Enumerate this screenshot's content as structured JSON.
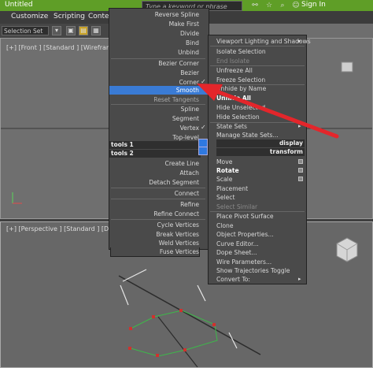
{
  "window": {
    "title": "Untitled"
  },
  "menubar": {
    "items": [
      "Customize",
      "Scripting",
      "Conte"
    ]
  },
  "search": {
    "placeholder": "Type a keyword or phrase"
  },
  "header_icons": [
    "binoculars-icon",
    "star-icon",
    "search-icon",
    "user-icon"
  ],
  "signin": "Sign In",
  "toolbar": {
    "selection_set": "Selection Set"
  },
  "viewports": {
    "front": "[+] [Front ] [Standard ] [Wireframe",
    "perspective": "[+] [Perspective ] [Standard ] [Defa"
  },
  "quad_left": {
    "group1": [
      {
        "label": "Reverse Spline",
        "checked": false
      },
      {
        "label": "Make First",
        "checked": false
      },
      {
        "label": "Divide",
        "checked": false
      },
      {
        "label": "Bind",
        "checked": false
      },
      {
        "label": "Unbind",
        "checked": false
      }
    ],
    "group2": [
      {
        "label": "Bezier Corner",
        "checked": false
      },
      {
        "label": "Bezier",
        "checked": false
      },
      {
        "label": "Corner",
        "checked": true
      },
      {
        "label": "Smooth",
        "checked": false,
        "highlighted": true
      },
      {
        "label": "Reset Tangents",
        "checked": false
      }
    ],
    "group3": [
      {
        "label": "Spline",
        "checked": false
      },
      {
        "label": "Segment",
        "checked": false
      },
      {
        "label": "Vertex",
        "checked": true
      },
      {
        "label": "Top-level",
        "checked": false
      }
    ],
    "header_tools1": "tools 1",
    "header_tools2": "tools 2",
    "group4": [
      {
        "label": "Create Line"
      },
      {
        "label": "Attach"
      },
      {
        "label": "Detach Segment"
      },
      {
        "label": "Connect"
      },
      {
        "label": "Refine"
      },
      {
        "label": "Refine Connect"
      },
      {
        "label": "Cycle Vertices"
      },
      {
        "label": "Break Vertices"
      },
      {
        "label": "Weld Vertices"
      },
      {
        "label": "Fuse Vertices"
      }
    ]
  },
  "quad_right": {
    "group1": [
      {
        "label": "Viewport Lighting and Shadows",
        "submenu": true
      },
      {
        "label": "Isolate Selection"
      },
      {
        "label": "End Isolate",
        "disabled": true
      },
      {
        "label": "Unfreeze All"
      },
      {
        "label": "Freeze Selection"
      },
      {
        "label": "Unhide by Name"
      },
      {
        "label": "Unhide All"
      },
      {
        "label": "Hide Unselected"
      },
      {
        "label": "Hide Selection"
      },
      {
        "label": "State Sets",
        "submenu": true
      },
      {
        "label": "Manage State Sets..."
      }
    ],
    "header_display": "display",
    "header_transform": "transform",
    "group2": [
      {
        "label": "Move",
        "box": true
      },
      {
        "label": "Rotate",
        "box": true,
        "bold": true
      },
      {
        "label": "Scale",
        "box": true
      },
      {
        "label": "Placement"
      },
      {
        "label": "Select"
      },
      {
        "label": "Select Similar",
        "disabled": true
      },
      {
        "label": "Place Pivot Surface"
      },
      {
        "label": "Clone"
      },
      {
        "label": "Object Properties..."
      },
      {
        "label": "Curve Editor..."
      },
      {
        "label": "Dope Sheet..."
      },
      {
        "label": "Wire Parameters..."
      },
      {
        "label": "Show Trajectories Toggle"
      },
      {
        "label": "Convert To:",
        "submenu": true
      }
    ]
  },
  "colors": {
    "titlebar": "#5f9e27",
    "highlight": "#3a7bd5",
    "arrow": "#e3262b",
    "spline_vertex": "#d0312d",
    "spline_segment": "#3db84a"
  }
}
